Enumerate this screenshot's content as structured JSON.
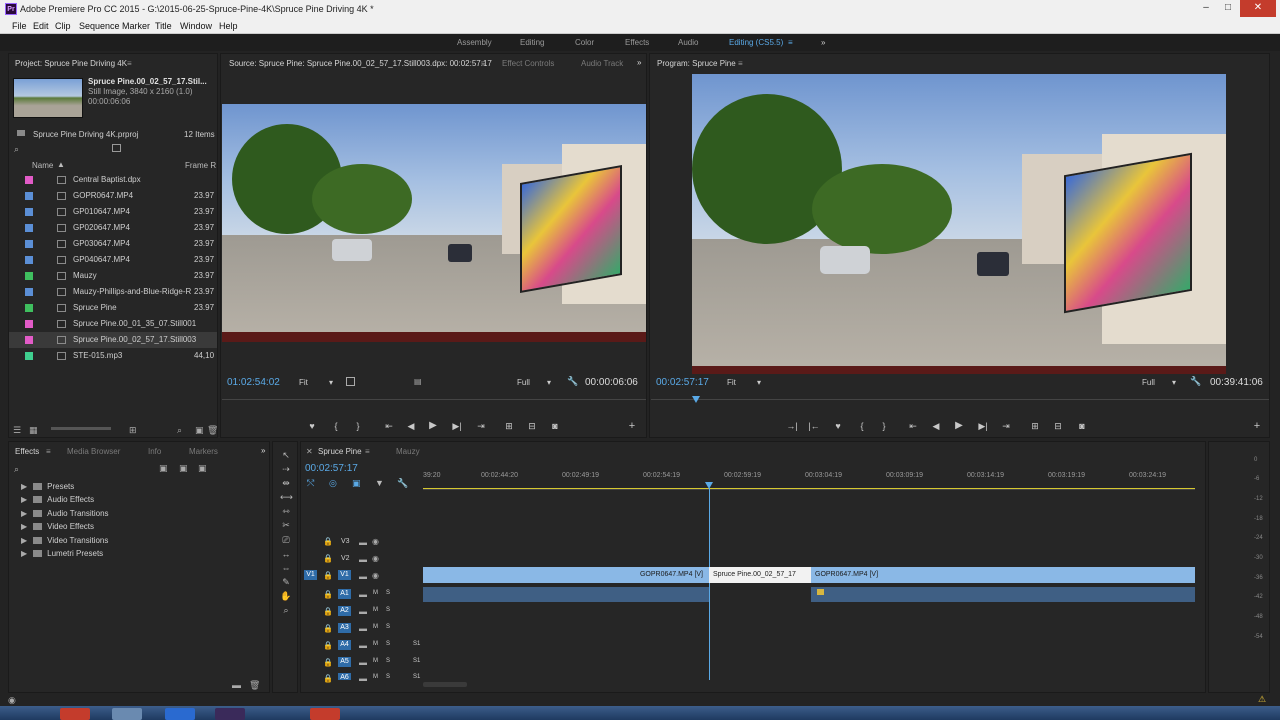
{
  "window": {
    "title": "Adobe Premiere Pro CC 2015 - G:\\2015-06-25-Spruce-Pine-4K\\Spruce Pine Driving 4K *",
    "logo": "Pr"
  },
  "menu": [
    "File",
    "Edit",
    "Clip",
    "Sequence",
    "Marker",
    "Title",
    "Window",
    "Help"
  ],
  "workspaces": [
    "Assembly",
    "Editing",
    "Color",
    "Effects",
    "Audio",
    "Editing (CS5.5)"
  ],
  "workspace_active": "Editing (CS5.5)",
  "project": {
    "tab": "Project: Spruce Pine Driving 4K",
    "preview_name": "Spruce Pine.00_02_57_17.Stil...",
    "preview_info": "Still Image, 3840 x 2160 (1.0)",
    "preview_duration": "00:00:06:06",
    "file": "Spruce Pine Driving 4K.prproj",
    "count": "12 Items",
    "col_name": "Name",
    "col_frame": "Frame R",
    "items": [
      {
        "name": "Central Baptist.dpx",
        "fps": "",
        "color": "#e25bc7"
      },
      {
        "name": "GOPR0647.MP4",
        "fps": "23.97",
        "color": "#5b8fd6"
      },
      {
        "name": "GP010647.MP4",
        "fps": "23.97",
        "color": "#5b8fd6"
      },
      {
        "name": "GP020647.MP4",
        "fps": "23.97",
        "color": "#5b8fd6"
      },
      {
        "name": "GP030647.MP4",
        "fps": "23.97",
        "color": "#5b8fd6"
      },
      {
        "name": "GP040647.MP4",
        "fps": "23.97",
        "color": "#5b8fd6"
      },
      {
        "name": "Mauzy",
        "fps": "23.97",
        "color": "#3fbf5f"
      },
      {
        "name": "Mauzy-Phillips-and-Blue-Ridge-R",
        "fps": "23.97",
        "color": "#5b8fd6"
      },
      {
        "name": "Spruce Pine",
        "fps": "23.97",
        "color": "#3fbf5f"
      },
      {
        "name": "Spruce Pine.00_01_35_07.Still001",
        "fps": "",
        "color": "#e25bc7"
      },
      {
        "name": "Spruce Pine.00_02_57_17.Still003",
        "fps": "",
        "color": "#e25bc7"
      },
      {
        "name": "STE-015.mp3",
        "fps": "44,10",
        "color": "#3fcf8f"
      }
    ]
  },
  "source": {
    "tab": "Source: Spruce Pine: Spruce Pine.00_02_57_17.Still003.dpx: 00:02:57:17",
    "tab2": "Effect Controls",
    "tab3": "Audio Track",
    "timecode": "01:02:54:02",
    "fit": "Fit",
    "quality": "Full",
    "duration": "00:00:06:06"
  },
  "program": {
    "tab": "Program: Spruce Pine",
    "timecode": "00:02:57:17",
    "fit": "Fit",
    "quality": "Full",
    "duration": "00:39:41:06"
  },
  "effects": {
    "tab": "Effects",
    "tab2": "Media Browser",
    "tab3": "Info",
    "tab4": "Markers",
    "items": [
      "Presets",
      "Audio Effects",
      "Audio Transitions",
      "Video Effects",
      "Video Transitions",
      "Lumetri Presets"
    ]
  },
  "timeline": {
    "tab": "Spruce Pine",
    "tab2": "Mauzy",
    "timecode": "00:02:57:17",
    "ruler": [
      "39:20",
      "00:02:44:20",
      "00:02:49:19",
      "00:02:54:19",
      "00:02:59:19",
      "00:03:04:19",
      "00:03:09:19",
      "00:03:14:19",
      "00:03:19:19",
      "00:03:24:19"
    ],
    "video_tracks": [
      "V3",
      "V2",
      "V1"
    ],
    "audio_tracks": [
      "A1",
      "A2",
      "A3",
      "A4",
      "A5",
      "A6"
    ],
    "clips": [
      "GOPR0647.MP4 [V]",
      "Spruce Pine.00_02_57_17",
      "GOPR0647.MP4 [V]"
    ],
    "v1_src": "V1",
    "m": "M",
    "s": "S",
    "s1": "S1"
  },
  "meter": [
    "0",
    "-6",
    "-12",
    "-18",
    "-24",
    "-30",
    "-36",
    "-42",
    "-48",
    "-54"
  ]
}
